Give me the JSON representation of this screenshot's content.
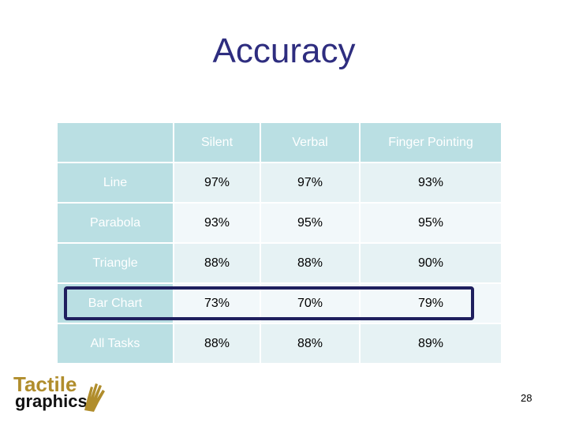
{
  "slide": {
    "title": "Accuracy",
    "page_number": "28",
    "logo": {
      "line1": "Tactile",
      "line2": "graphics",
      "icon": "hand-icon"
    }
  },
  "table": {
    "columns": [
      "",
      "Silent",
      "Verbal",
      "Finger Pointing"
    ],
    "rows": [
      {
        "label": "Line",
        "values": [
          "97%",
          "97%",
          "93%"
        ]
      },
      {
        "label": "Parabola",
        "values": [
          "93%",
          "95%",
          "95%"
        ]
      },
      {
        "label": "Triangle",
        "values": [
          "88%",
          "88%",
          "90%"
        ]
      },
      {
        "label": "Bar Chart",
        "values": [
          "73%",
          "70%",
          "79%"
        ],
        "highlighted": true
      },
      {
        "label": "All Tasks",
        "values": [
          "88%",
          "88%",
          "89%"
        ]
      }
    ]
  },
  "colors": {
    "title": "#2e2d7f",
    "header_bg": "#badfe3",
    "highlight_border": "#1f1f5e",
    "logo_gold": "#b08d2c"
  }
}
